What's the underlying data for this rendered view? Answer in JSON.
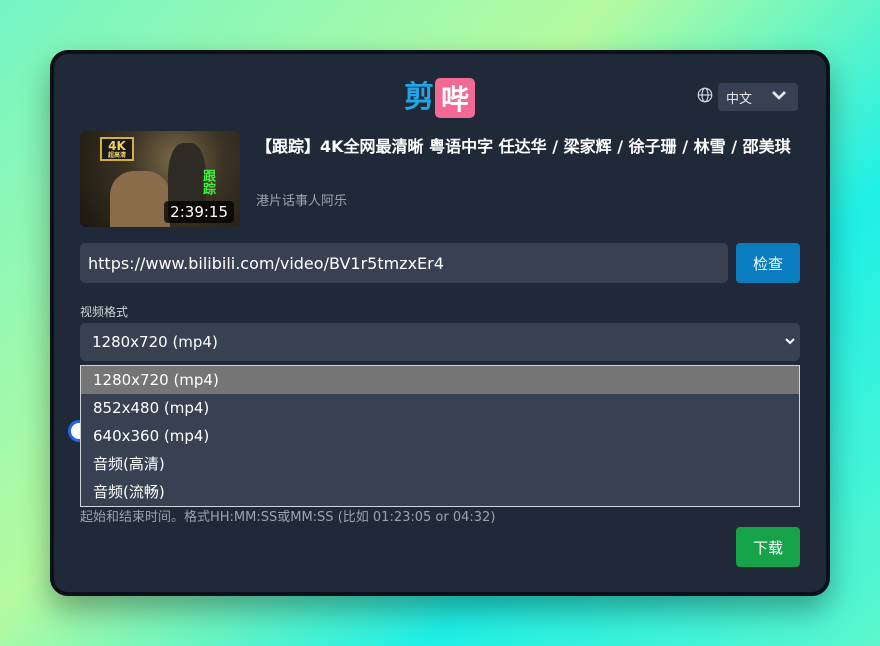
{
  "logo": {
    "part1": "剪",
    "part2": "哔"
  },
  "language": {
    "selected": "中文"
  },
  "video": {
    "title": "【跟踪】4K全网最清晰 粤语中字 任达华 / 梁家辉 / 徐子珊 / 林雪 / 邵美琪",
    "author": "港片话事人阿乐",
    "duration": "2:39:15",
    "thumb_badge": "4K",
    "thumb_badge_sub": "超高清",
    "thumb_caption": "跟踪"
  },
  "url_input": {
    "value": "https://www.bilibili.com/video/BV1r5tmzxEr4"
  },
  "check_button": {
    "label": "检查"
  },
  "format": {
    "label": "视频格式",
    "selected": "1280x720 (mp4)",
    "options": [
      "1280x720 (mp4)",
      "852x480 (mp4)",
      "640x360 (mp4)",
      "音频(高清)",
      "音频(流畅)"
    ]
  },
  "hint": "起始和结束时间。格式HH:MM:SS或MM:SS (比如 01:23:05 or 04:32)",
  "download_button": {
    "label": "下载"
  },
  "colors": {
    "card_bg": "#1f2937",
    "check_button": "#0a7cc0",
    "download_button": "#16a34a",
    "logo_blue": "#23a5e8",
    "logo_pink": "#f26a93"
  }
}
